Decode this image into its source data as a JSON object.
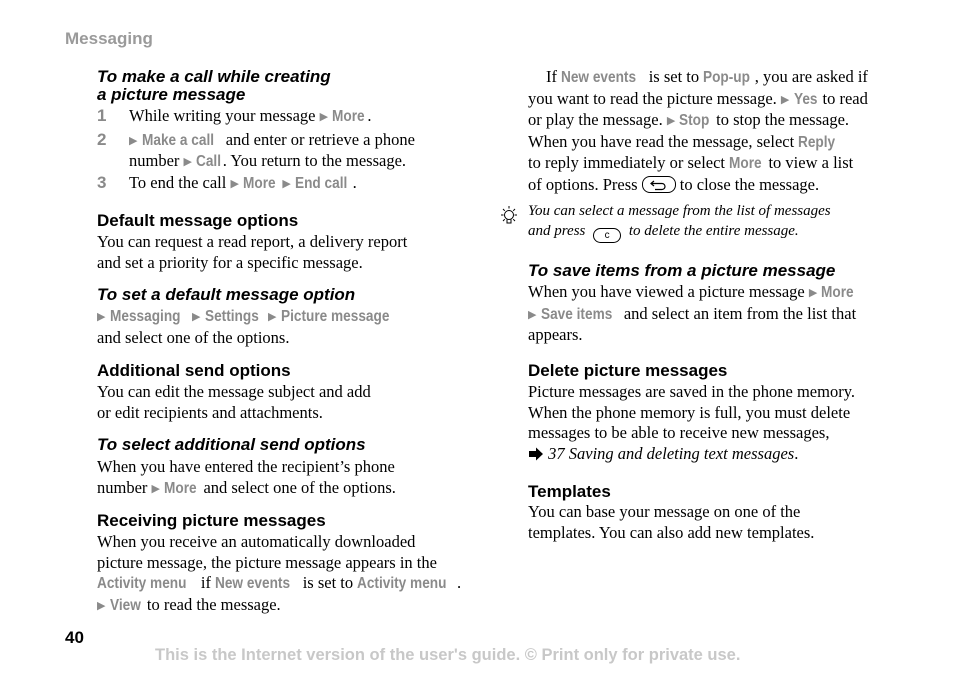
{
  "header": {
    "section": "Messaging"
  },
  "left": {
    "call_title_l1": "To make a call while creating",
    "call_title_l2": "a picture message",
    "steps": [
      {
        "num": "1",
        "pre": "While writing your message",
        "menu1": "More",
        "post": "."
      },
      {
        "num": "2",
        "menu1": "Make a call",
        "mid": "and enter or retrieve a phone",
        "l2pre": "number",
        "menu2": "Call",
        "l2post": ". You return to the message."
      },
      {
        "num": "3",
        "pre": "To end the call",
        "menu1": "More",
        "menu2": "End call",
        "post": "."
      }
    ],
    "default_title": "Default message options",
    "default_body_l1": "You can request a read report, a delivery report",
    "default_body_l2": "and set a priority for a specific message.",
    "set_default_title": "To set a default message option",
    "set_default_path": [
      "Messaging",
      "Settings",
      "Picture message"
    ],
    "set_default_body": "and select one of the options.",
    "additional_title": "Additional send options",
    "additional_body_l1": "You can edit the message subject and add",
    "additional_body_l2": "or edit recipients and attachments.",
    "select_additional_title": "To select additional send options",
    "select_additional_l1": "When you have entered the recipient’s phone",
    "select_additional_l2pre": "number",
    "select_additional_menu": "More",
    "select_additional_l2post": "and select one of the options.",
    "receiving_title": "Receiving picture messages",
    "receiving_l1": "When you receive an automatically downloaded",
    "receiving_l2": "picture message, the picture message appears in the",
    "receiving_menu1": "Activity menu",
    "receiving_if": "if",
    "receiving_menu2": "New events",
    "receiving_setto": "is set to",
    "receiving_menu3": "Activity menu",
    "receiving_dot": ".",
    "receiving_menu4": "View",
    "receiving_l4post": "to read the message."
  },
  "right": {
    "p1_if": "If",
    "p1_menu1": "New events",
    "p1_setto": "is set to",
    "p1_menu2": "Pop-up",
    "p1_l1post": ", you are asked if",
    "p1_l2pre": "you want to read the picture message.",
    "p1_menu3": "Yes",
    "p1_l2post": "to read",
    "p1_l3pre": "or play the message.",
    "p1_menu4": "Stop",
    "p1_l3post": "to stop the message.",
    "p1_l4pre": "When you have read the message, select",
    "p1_menu5": "Reply",
    "p1_l5pre": "to reply immediately or select",
    "p1_menu6": "More",
    "p1_l5post": "to view a list",
    "p1_l6pre": "of options. Press",
    "p1_l6post": "to close the message.",
    "tip_l1": "You can select a message from the list of messages",
    "tip_l2pre": "and press",
    "tip_key": "c",
    "tip_l2post": "to delete the entire message.",
    "save_title": "To save items from a picture message",
    "save_l1pre": "When you have viewed a picture message",
    "save_menu1": "More",
    "save_menu2": "Save items",
    "save_l2post": "and select an item from the list that",
    "save_l3": "appears.",
    "delete_title": "Delete picture messages",
    "delete_l1": "Picture messages are saved in the phone memory.",
    "delete_l2": "When the phone memory is full, you must delete",
    "delete_l3": "messages to be able to receive new messages,",
    "delete_ref": "37 Saving and deleting text messages",
    "delete_ref_dot": ".",
    "templates_title": "Templates",
    "templates_l1": "You can base your message on one of the",
    "templates_l2": "templates. You can also add new templates."
  },
  "footer": {
    "page_number": "40",
    "notice": "This is the Internet version of the user's guide. © Print only for private use."
  },
  "colors": {
    "menu_gray": "#8a8a8a",
    "footer_gray": "#c8c8c8",
    "section_gray": "#9a9a9a"
  }
}
